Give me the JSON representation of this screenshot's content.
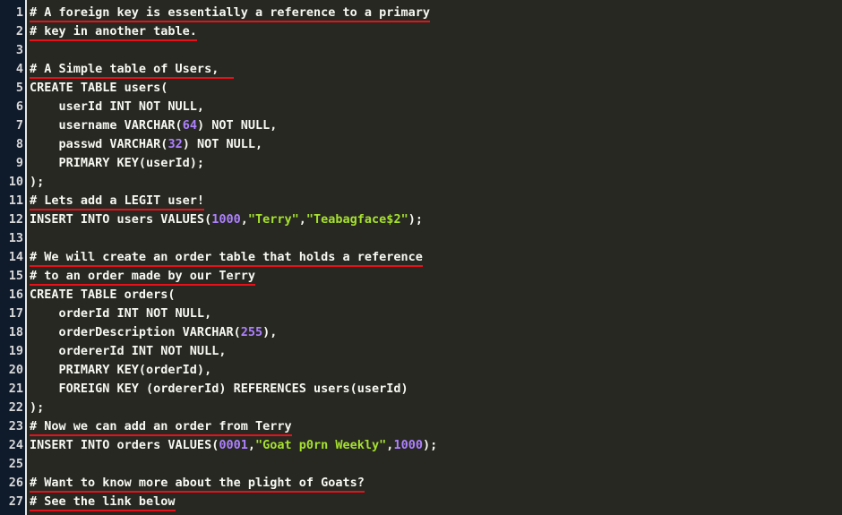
{
  "editor": {
    "colors": {
      "background": "#272822",
      "gutter": "#0f1a2b",
      "text": "#f8f8f2",
      "number": "#ae81ff",
      "string": "#a6e22e",
      "spellcheck_underline": "#e8101a"
    },
    "lines": [
      {
        "n": "1",
        "tokens": [
          {
            "t": "comment",
            "v": "# A foreign key is essentially a reference to a primary"
          }
        ]
      },
      {
        "n": "2",
        "tokens": [
          {
            "t": "comment",
            "v": "# key in another table."
          }
        ]
      },
      {
        "n": "3",
        "tokens": []
      },
      {
        "n": "4",
        "tokens": [
          {
            "t": "comment",
            "v": "# A Simple table of Users,  "
          }
        ]
      },
      {
        "n": "5",
        "tokens": [
          {
            "t": "plain",
            "v": "CREATE TABLE users("
          }
        ]
      },
      {
        "n": "6",
        "tokens": [
          {
            "t": "plain",
            "v": "    userId INT NOT NULL,"
          }
        ]
      },
      {
        "n": "7",
        "tokens": [
          {
            "t": "plain",
            "v": "    username VARCHAR("
          },
          {
            "t": "num",
            "v": "64"
          },
          {
            "t": "plain",
            "v": ") NOT NULL,"
          }
        ]
      },
      {
        "n": "8",
        "tokens": [
          {
            "t": "plain",
            "v": "    passwd VARCHAR("
          },
          {
            "t": "num",
            "v": "32"
          },
          {
            "t": "plain",
            "v": ") NOT NULL,"
          }
        ]
      },
      {
        "n": "9",
        "tokens": [
          {
            "t": "plain",
            "v": "    PRIMARY KEY(userId);"
          }
        ]
      },
      {
        "n": "10",
        "tokens": [
          {
            "t": "plain",
            "v": ");"
          }
        ]
      },
      {
        "n": "11",
        "tokens": [
          {
            "t": "comment",
            "v": "# Lets add a LEGIT user!"
          }
        ]
      },
      {
        "n": "12",
        "tokens": [
          {
            "t": "plain",
            "v": "INSERT INTO users VALUES("
          },
          {
            "t": "num",
            "v": "1000"
          },
          {
            "t": "plain",
            "v": ","
          },
          {
            "t": "str",
            "v": "\"Terry\""
          },
          {
            "t": "plain",
            "v": ","
          },
          {
            "t": "str",
            "v": "\"Teabagface$2\""
          },
          {
            "t": "plain",
            "v": ");"
          }
        ]
      },
      {
        "n": "13",
        "tokens": []
      },
      {
        "n": "14",
        "tokens": [
          {
            "t": "comment",
            "v": "# We will create an order table that holds a reference"
          }
        ]
      },
      {
        "n": "15",
        "tokens": [
          {
            "t": "comment",
            "v": "# to an order made by our Terry"
          }
        ]
      },
      {
        "n": "16",
        "tokens": [
          {
            "t": "plain",
            "v": "CREATE TABLE orders("
          }
        ]
      },
      {
        "n": "17",
        "tokens": [
          {
            "t": "plain",
            "v": "    orderId INT NOT NULL,"
          }
        ]
      },
      {
        "n": "18",
        "tokens": [
          {
            "t": "plain",
            "v": "    orderDescription VARCHAR("
          },
          {
            "t": "num",
            "v": "255"
          },
          {
            "t": "plain",
            "v": "),"
          }
        ]
      },
      {
        "n": "19",
        "tokens": [
          {
            "t": "plain",
            "v": "    ordererId INT NOT NULL,"
          }
        ]
      },
      {
        "n": "20",
        "tokens": [
          {
            "t": "plain",
            "v": "    PRIMARY KEY(orderId),"
          }
        ]
      },
      {
        "n": "21",
        "tokens": [
          {
            "t": "plain",
            "v": "    FOREIGN KEY (ordererId) REFERENCES users(userId)"
          }
        ]
      },
      {
        "n": "22",
        "tokens": [
          {
            "t": "plain",
            "v": ");"
          }
        ]
      },
      {
        "n": "23",
        "tokens": [
          {
            "t": "comment",
            "v": "# Now we can add an order from Terry"
          }
        ]
      },
      {
        "n": "24",
        "tokens": [
          {
            "t": "plain",
            "v": "INSERT INTO orders VALUES("
          },
          {
            "t": "num",
            "v": "0001"
          },
          {
            "t": "plain",
            "v": ","
          },
          {
            "t": "str",
            "v": "\"Goat p0rn Weekly\""
          },
          {
            "t": "plain",
            "v": ","
          },
          {
            "t": "num",
            "v": "1000"
          },
          {
            "t": "plain",
            "v": ");"
          }
        ]
      },
      {
        "n": "25",
        "tokens": []
      },
      {
        "n": "26",
        "tokens": [
          {
            "t": "comment",
            "v": "# Want to know more about the plight of Goats?"
          }
        ]
      },
      {
        "n": "27",
        "tokens": [
          {
            "t": "comment",
            "v": "# See the link below"
          }
        ]
      }
    ]
  }
}
